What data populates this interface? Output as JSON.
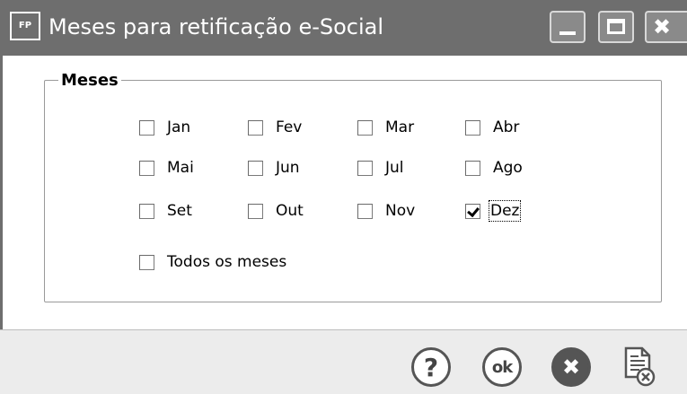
{
  "window": {
    "app_icon_text": "FP",
    "title": "Meses para retificação e-Social",
    "close_glyph": "✖"
  },
  "group": {
    "legend": "Meses"
  },
  "months": [
    {
      "label": "Jan",
      "checked": false
    },
    {
      "label": "Fev",
      "checked": false
    },
    {
      "label": "Mar",
      "checked": false
    },
    {
      "label": "Abr",
      "checked": false
    },
    {
      "label": "Mai",
      "checked": false
    },
    {
      "label": "Jun",
      "checked": false
    },
    {
      "label": "Jul",
      "checked": false
    },
    {
      "label": "Ago",
      "checked": false
    },
    {
      "label": "Set",
      "checked": false
    },
    {
      "label": "Out",
      "checked": false
    },
    {
      "label": "Nov",
      "checked": false
    },
    {
      "label": "Dez",
      "checked": true
    }
  ],
  "all_months": {
    "label": "Todos os meses",
    "checked": false
  },
  "buttons": {
    "help_glyph": "?",
    "ok_glyph": "ok",
    "cancel_glyph": "✖"
  },
  "icons": {
    "help": "help-icon",
    "ok": "ok-icon",
    "cancel": "cancel-icon",
    "report": "report-icon"
  }
}
